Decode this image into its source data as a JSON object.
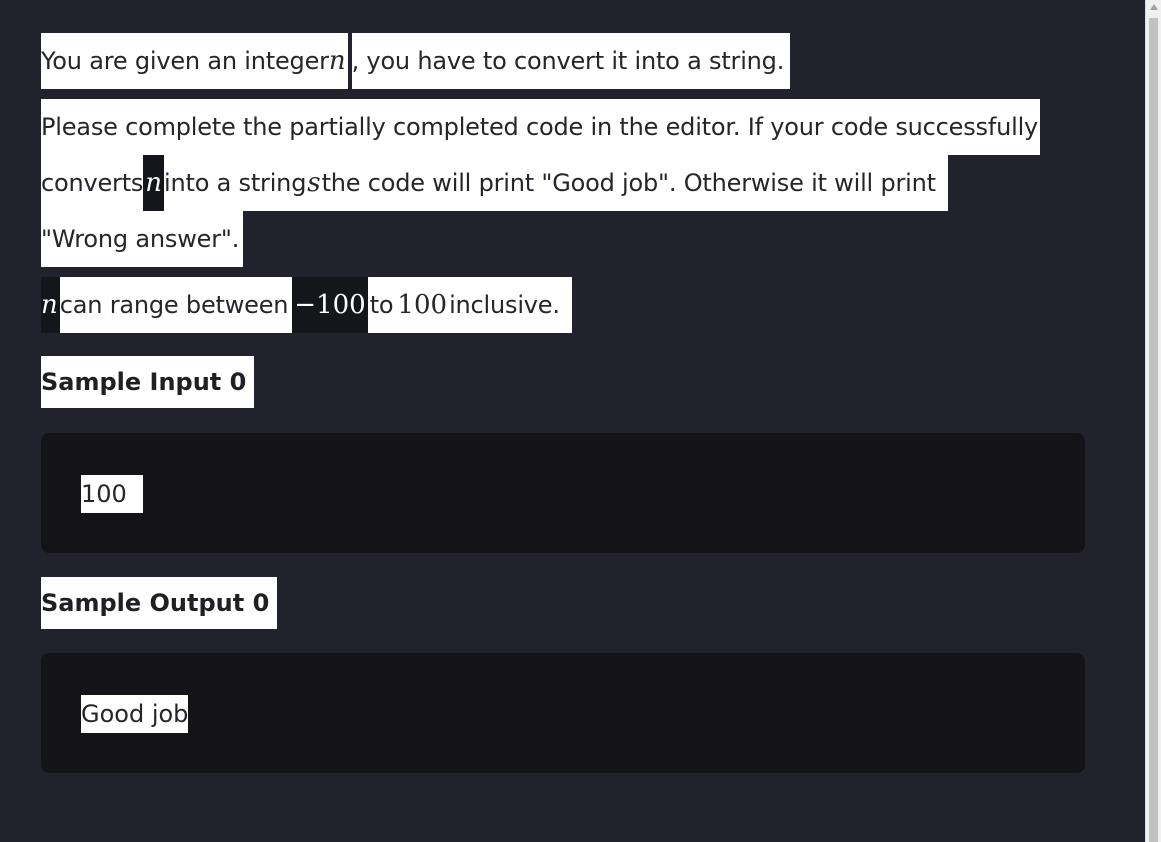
{
  "statement": {
    "line1": {
      "before": "You are given an integer ",
      "var": "n",
      "after": ", you have to convert it into a string."
    },
    "line2": "Please complete the partially completed code in the editor. If your code successfully",
    "line3": {
      "before": "converts ",
      "var_n": "n",
      "middle": " into a string ",
      "var_s": "s",
      "after": " the code will print \"Good job\". Otherwise it will print"
    },
    "line4": "\"Wrong answer\".",
    "constraint": {
      "var": "n",
      "text1": " can range between ",
      "min": "−100",
      "text2": " to ",
      "max": "100",
      "text3": " inclusive."
    }
  },
  "sample_input": {
    "heading": "Sample Input 0",
    "value": "100"
  },
  "sample_output": {
    "heading": "Sample Output 0",
    "value": "Good job"
  },
  "colors": {
    "background": "#22222d",
    "code_background": "#141418",
    "highlight": "#ffffff"
  }
}
